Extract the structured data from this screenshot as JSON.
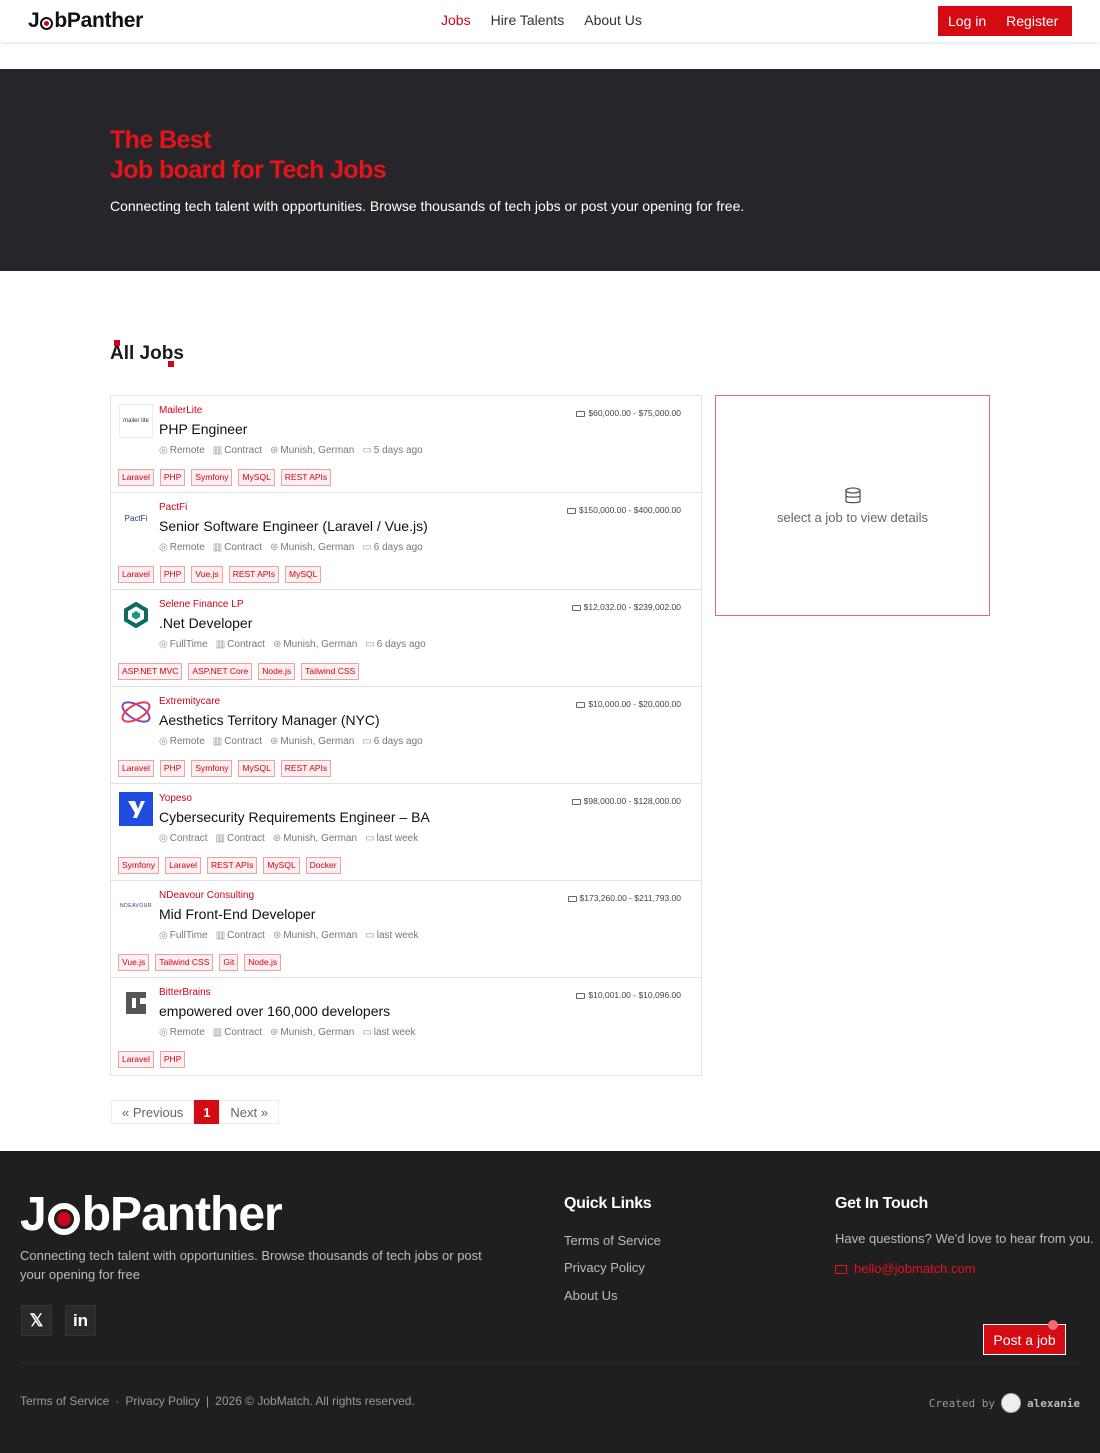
{
  "header": {
    "logo": "JobPanther",
    "nav": [
      "Jobs",
      "Hire Talents",
      "About Us"
    ],
    "login": "Log in",
    "register": "Register"
  },
  "hero": {
    "title_line1": "The Best",
    "title_line2": "Job board for Tech Jobs",
    "subtitle": "Connecting tech talent with opportunities. Browse thousands of tech jobs or post your opening for free."
  },
  "section_title": "All Jobs",
  "jobs": [
    {
      "company": "MailerLite",
      "title": "PHP Engineer",
      "salary": "$60,000.00 - $75,000.00",
      "workplace": "Remote",
      "type": "Contract",
      "location": "Munish, German",
      "posted": "5 days ago",
      "tags": [
        "Laravel",
        "PHP",
        "Symfony",
        "MySQL",
        "REST APIs"
      ]
    },
    {
      "company": "PactFi",
      "title": "Senior Software Engineer (Laravel / Vue.js)",
      "salary": "$150,000.00 - $400,000.00",
      "workplace": "Remote",
      "type": "Contract",
      "location": "Munish, German",
      "posted": "6 days ago",
      "tags": [
        "Laravel",
        "PHP",
        "Vue.js",
        "REST APIs",
        "MySQL"
      ]
    },
    {
      "company": "Selene Finance LP",
      "title": ".Net Developer",
      "salary": "$12,032.00 - $239,002.00",
      "workplace": "FullTime",
      "type": "Contract",
      "location": "Munish, German",
      "posted": "6 days ago",
      "tags": [
        "ASP.NET MVC",
        "ASP.NET Core",
        "Node.js",
        "Tailwind CSS"
      ]
    },
    {
      "company": "Extremitycare",
      "title": "Aesthetics Territory Manager (NYC)",
      "salary": "$10,000.00 - $20,000.00",
      "workplace": "Remote",
      "type": "Contract",
      "location": "Munish, German",
      "posted": "6 days ago",
      "tags": [
        "Laravel",
        "PHP",
        "Symfony",
        "MySQL",
        "REST APIs"
      ]
    },
    {
      "company": "Yopeso",
      "title": "Cybersecurity Requirements Engineer – BA",
      "salary": "$98,000.00 - $128,000.00",
      "workplace": "Contract",
      "type": "Contract",
      "location": "Munish, German",
      "posted": "last week",
      "tags": [
        "Symfony",
        "Laravel",
        "REST APIs",
        "MySQL",
        "Docker"
      ]
    },
    {
      "company": "NDeavour Consulting",
      "title": "Mid Front-End Developer",
      "salary": "$173,260.00 - $211,793.00",
      "workplace": "FullTime",
      "type": "Contract",
      "location": "Munish, German",
      "posted": "last week",
      "tags": [
        "Vue.js",
        "Tailwind CSS",
        "Git",
        "Node.js"
      ]
    },
    {
      "company": "BitterBrains",
      "title": "empowered over 160,000 developers",
      "salary": "$10,001.00 - $10,096.00",
      "workplace": "Remote",
      "type": "Contract",
      "location": "Munish, German",
      "posted": "last week",
      "tags": [
        "Laravel",
        "PHP"
      ]
    }
  ],
  "company_logo_text": {
    "mailerlite": "mailer lite",
    "pactfi": "PactFi",
    "ndeavour": "NDEAVOUR"
  },
  "details_placeholder": "select a job to view details",
  "pagination": {
    "prev": "« Previous",
    "current": "1",
    "next": "Next »"
  },
  "footer": {
    "logo": "JobPanther",
    "description": "Connecting tech talent with opportunities. Browse thousands of tech jobs or post your opening for free",
    "social_x": "𝕏",
    "social_linkedin": "in",
    "quick_links_title": "Quick Links",
    "quick_links": [
      "Terms of Service",
      "Privacy Policy",
      "About Us"
    ],
    "contact_title": "Get In Touch",
    "contact_text": "Have questions? We'd love to hear from you.",
    "email": "hello@jobmatch.com",
    "post_job": "Post a job",
    "bottom_links": [
      "Terms of Service",
      "·",
      "Privacy Policy",
      "|",
      "2026 © JobMatch. All rights reserved."
    ],
    "credit_prefix": "Created by",
    "credit_name": "alexanie"
  },
  "colors": {
    "brand": "#d40b12",
    "hero_bg": "#26262a",
    "footer_bg": "#1f1f1f"
  }
}
